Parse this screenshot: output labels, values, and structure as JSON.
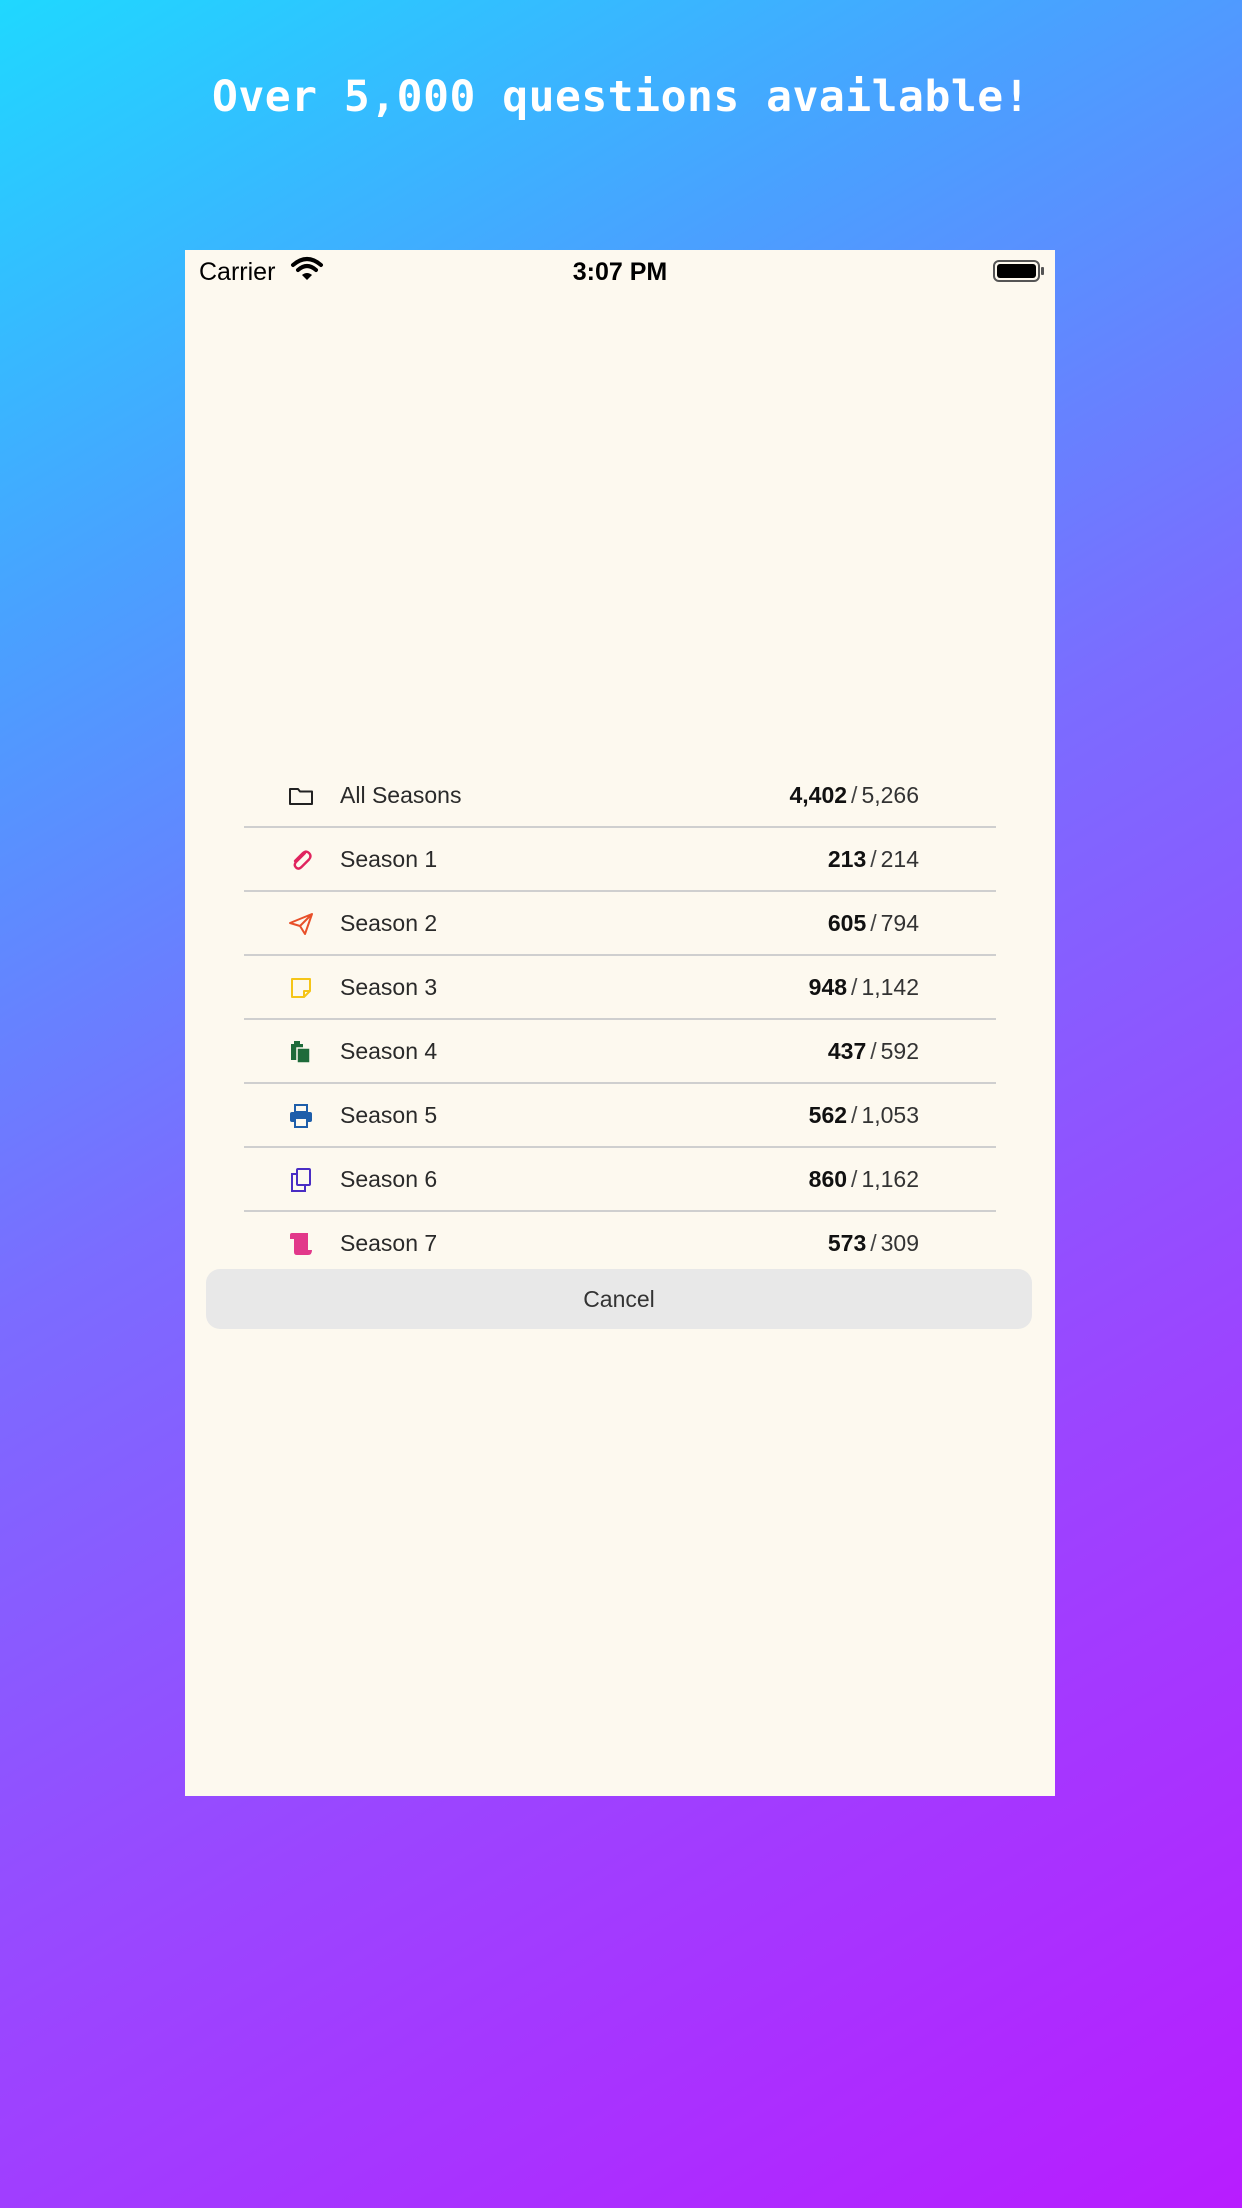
{
  "promo": {
    "title": "Over 5,000 questions available!"
  },
  "status_bar": {
    "carrier": "Carrier",
    "time": "3:07 PM"
  },
  "seasons": [
    {
      "label": "All Seasons",
      "done": "4,402",
      "total": "5,266",
      "icon": "folder-icon",
      "color": "#222222"
    },
    {
      "label": "Season 1",
      "done": "213",
      "total": "214",
      "icon": "paperclip-icon",
      "color": "#e0245e"
    },
    {
      "label": "Season 2",
      "done": "605",
      "total": "794",
      "icon": "paper-plane-icon",
      "color": "#e8502a"
    },
    {
      "label": "Season 3",
      "done": "948",
      "total": "1,142",
      "icon": "sticky-note-icon",
      "color": "#f5c518"
    },
    {
      "label": "Season 4",
      "done": "437",
      "total": "592",
      "icon": "clipboard-icon",
      "color": "#1e6b3a"
    },
    {
      "label": "Season 5",
      "done": "562",
      "total": "1,053",
      "icon": "printer-icon",
      "color": "#1e5eaa"
    },
    {
      "label": "Season 6",
      "done": "860",
      "total": "1,162",
      "icon": "copy-icon",
      "color": "#4a2dc4"
    },
    {
      "label": "Season 7",
      "done": "573",
      "total": "309",
      "icon": "scroll-icon",
      "color": "#e2388a"
    }
  ],
  "count_separator": "/",
  "cancel_label": "Cancel"
}
